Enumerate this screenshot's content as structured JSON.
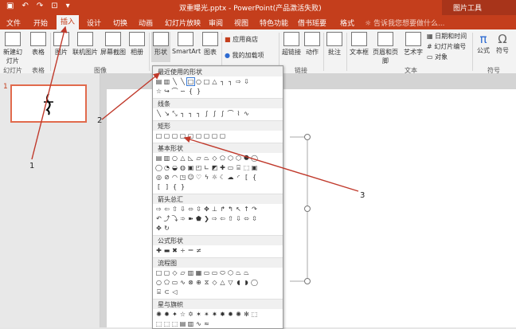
{
  "titlebar": {
    "title": "双重曝光.pptx - PowerPoint(产品激活失败)",
    "contextual": "图片工具"
  },
  "tabs": [
    "文件",
    "开始",
    "插入",
    "设计",
    "切换",
    "动画",
    "幻灯片放映",
    "审阅",
    "视图",
    "特色功能",
    "借书瑶要",
    "格式"
  ],
  "tellme": "告诉我您想要做什么...",
  "ribbon": {
    "buttons": {
      "new_slide": "新建幻灯片",
      "table": "表格",
      "picture": "图片",
      "online_picture": "联机图片",
      "screenshot": "屏幕截图",
      "album": "相册",
      "shapes": "形状",
      "smartart": "SmartArt",
      "chart": "图表",
      "store": "应用商店",
      "my_addins": "我的加载项",
      "hyperlink": "超链接",
      "action": "动作",
      "comment": "批注",
      "textbox": "文本框",
      "header_footer": "页眉和页脚",
      "wordart": "艺术字",
      "datetime": "日期和时间",
      "slide_number": "幻灯片编号",
      "object": "对象",
      "formula": "公式",
      "symbol": "符号"
    },
    "groups": {
      "slides": "幻灯片",
      "tables": "表格",
      "images": "图像",
      "links": "链接",
      "text": "文本",
      "symbols": "符号"
    }
  },
  "thumbnail": {
    "number": "1"
  },
  "shapes_menu": {
    "sections": [
      "最近使用的形状",
      "线条",
      "矩形",
      "基本形状",
      "箭头总汇",
      "公式形状",
      "流程图",
      "星与旗帜"
    ]
  },
  "annotations": [
    "1",
    "2",
    "3"
  ],
  "colors": {
    "brand": "#c43e1c",
    "arrow": "#c0392b"
  }
}
